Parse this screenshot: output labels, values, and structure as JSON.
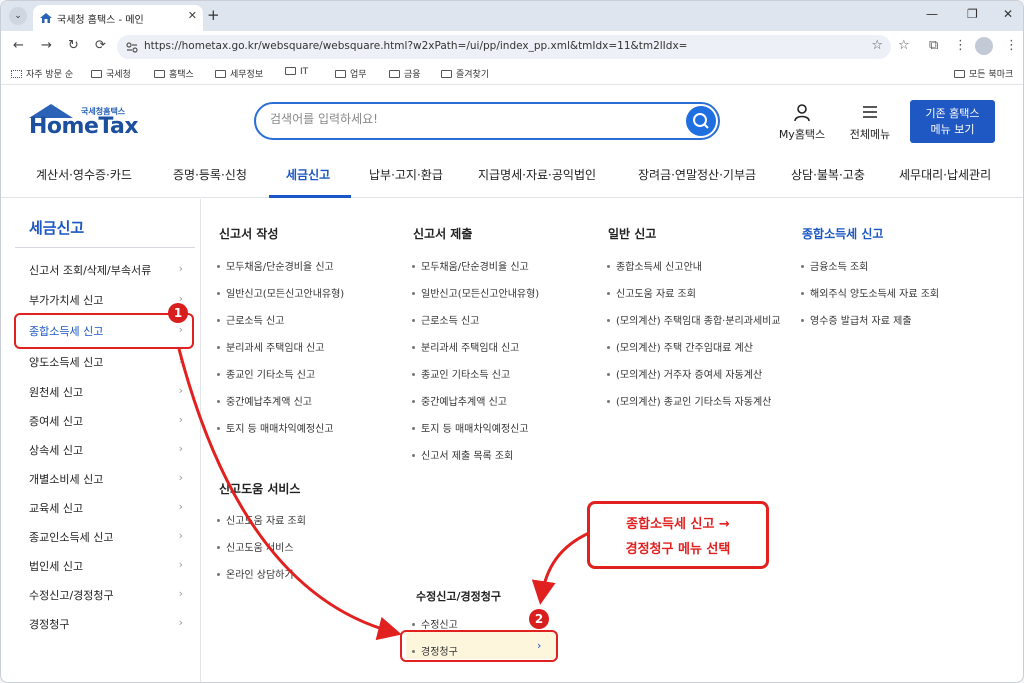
{
  "browser": {
    "tab_title": "국세청 홈택스 - 메인",
    "url": "https://hometax.go.kr/websquare/websquare.html?w2xPath=/ui/pp/index_pp.xml&tmIdx=11&tm2lIdx=",
    "bookmarks": [
      "자주 방문 순",
      "국세청",
      "홈택스",
      "세무정보",
      "IT",
      "업무",
      "금융",
      "즐겨찾기"
    ],
    "bookmarks_right": "모든 북마크"
  },
  "header": {
    "logo_sub": "국세청홈택스",
    "logo_main": "HomeTax",
    "search_placeholder": "검색어를 입력하세요!",
    "my_hometax": "My홈택스",
    "all_menu": "전체메뉴",
    "old_hometax_line1": "기존 홈택스",
    "old_hometax_line2": "메뉴 보기"
  },
  "mainnav": [
    "계산서·영수증·카드",
    "증명·등록·신청",
    "세금신고",
    "납부·고지·환급",
    "지급명세·자료·공익법인",
    "장려금·연말정산·기부금",
    "상담·불복·고충",
    "세무대리·납세관리"
  ],
  "sidebar": {
    "title": "세금신고",
    "items": [
      "신고서 조회/삭제/부속서류",
      "부가가치세 신고",
      "종합소득세 신고",
      "양도소득세 신고",
      "원천세 신고",
      "증여세 신고",
      "상속세 신고",
      "개별소비세 신고",
      "교육세 신고",
      "종교인소득세 신고",
      "법인세 신고",
      "수정신고/경정청구",
      "경정청구"
    ]
  },
  "menu": {
    "col1_title": "신고서 작성",
    "col1_items": [
      "모두채움/단순경비율 신고",
      "일반신고(모든신고안내유형)",
      "근로소득 신고",
      "분리과세 주택임대 신고",
      "종교인 기타소득 신고",
      "중간예납추계액 신고",
      "토지 등 매매차익예정신고"
    ],
    "col1b_title": "신고도움 서비스",
    "col1b_items": [
      "신고도움 자료 조회",
      "신고도움 서비스",
      "온라인 상담하기"
    ],
    "col2_title": "신고서 제출",
    "col2_items": [
      "모두채움/단순경비율 신고",
      "일반신고(모든신고안내유형)",
      "근로소득 신고",
      "분리과세 주택임대 신고",
      "종교인 기타소득 신고",
      "중간예납추계액 신고",
      "토지 등 매매차익예정신고",
      "신고서 제출 목록 조회"
    ],
    "col2b_title": "수정신고/경정청구",
    "col2b_items": [
      "수정신고",
      "경정청구"
    ],
    "col3_title": "일반 신고",
    "col3_items": [
      "종합소득세 신고안내",
      "신고도움 자료 조회",
      "(모의계산) 주택임대 종합·분리과세비교",
      "(모의계산) 주택 간주임대료 계산",
      "(모의계산) 거주자 증여세 자동계산",
      "(모의계산) 종교인 기타소득 자동계산"
    ],
    "col4_title": "종합소득세 신고",
    "col4_items": [
      "금융소득 조회",
      "해외주식 양도소득세 자료 조회",
      "영수증 발급처 자료 제출"
    ]
  },
  "annotations": {
    "badge1": "1",
    "badge2": "2",
    "callout_line1": "종합소득세 신고 →",
    "callout_line2": "경정청구 메뉴 선택",
    "color": "#e12020"
  }
}
